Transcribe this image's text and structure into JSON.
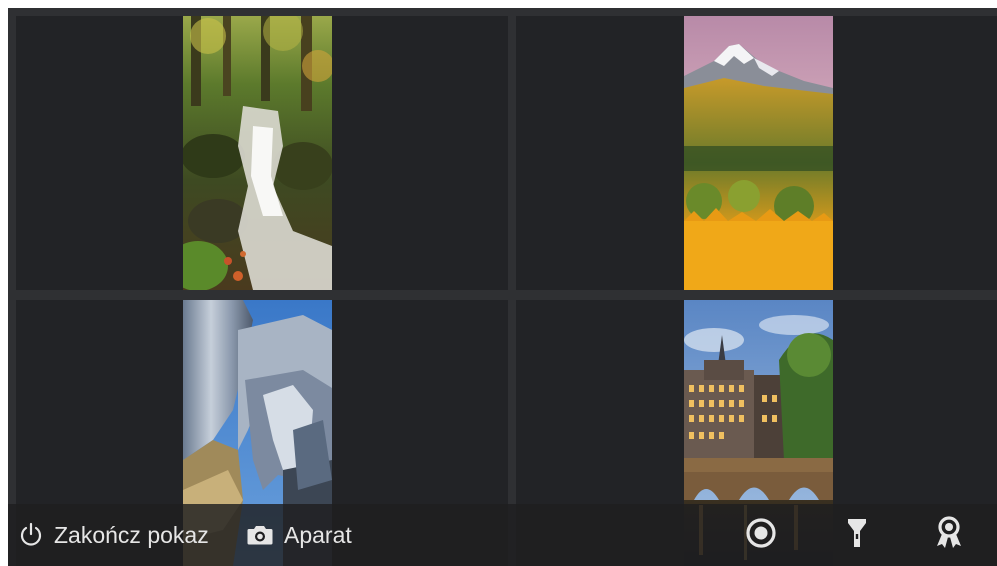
{
  "gallery": {
    "tiles": [
      {
        "subject": "forest-waterfall"
      },
      {
        "subject": "autumn-mountain"
      },
      {
        "subject": "modern-metal-building"
      },
      {
        "subject": "amsterdam-canal-bridge"
      }
    ]
  },
  "bottom_bar": {
    "end_show_label": "Zakończ pokaz",
    "camera_label": "Aparat",
    "icons": [
      "power-icon",
      "camera-icon",
      "record-icon",
      "flashlight-icon",
      "award-icon"
    ]
  },
  "colors": {
    "background": "#2f3033",
    "tile": "#222326",
    "bar": "#1e1e20",
    "text": "#e6e6e6"
  }
}
